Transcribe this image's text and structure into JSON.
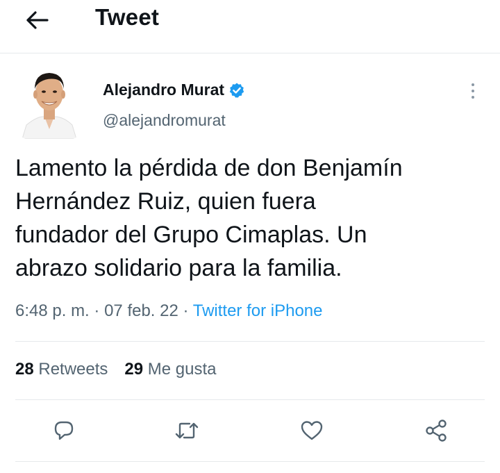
{
  "header": {
    "title": "Tweet",
    "back_icon": "arrow-left-icon"
  },
  "author": {
    "name": "Alejandro Murat",
    "handle": "@alejandromurat",
    "verified": true,
    "verified_color": "#1d9bf0"
  },
  "tweet": {
    "text_lines": [
      "Lamento la pérdida de don Benjamín",
      "Hernández Ruiz, quien fuera",
      "fundador del Grupo Cimaplas. Un",
      "abrazo solidario para la familia."
    ],
    "time": "6:48 p. m.",
    "date": "07 feb. 22",
    "source": "Twitter for iPhone",
    "separator": "·"
  },
  "stats": {
    "retweets_count": "28",
    "retweets_label": "Retweets",
    "likes_count": "29",
    "likes_label": "Me gusta"
  },
  "actions": [
    "reply-icon",
    "retweet-icon",
    "like-icon",
    "share-icon"
  ],
  "colors": {
    "accent": "#1d9bf0",
    "secondary_text": "#536471",
    "primary_text": "#0f1419",
    "divider": "#e6e9eb"
  }
}
